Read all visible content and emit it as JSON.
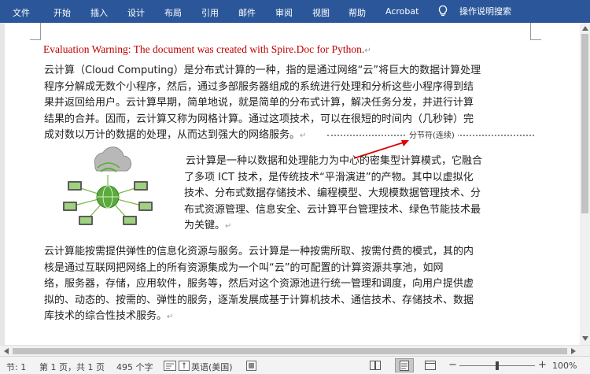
{
  "ribbon": {
    "tabs": [
      "文件",
      "开始",
      "插入",
      "设计",
      "布局",
      "引用",
      "邮件",
      "审阅",
      "视图",
      "帮助",
      "Acrobat"
    ],
    "help_label": "操作说明搜索",
    "color": "#2b579a"
  },
  "document": {
    "warning": "Evaluation Warning: The document was created with Spire.Doc for Python.",
    "para1_lines": [
      "云计算（Cloud Computing）是分布式计算的一种，指的是通过网络“云”将巨大的数据计算处理",
      "程序分解成无数个小程序，然后，通过多部服务器组成的系统进行处理和分析这些小程序得到结",
      "果并返回给用户。云计算早期，简单地说，就是简单的分布式计算，解决任务分发，并进行计算",
      "结果的合并。因而，云计算又称为网格计算。通过这项技术，可以在很短的时间内（几秒钟）完",
      "成对数以万计的数据的处理，从而达到强大的网络服务。"
    ],
    "section_break_label": "分节符(连续)",
    "para2_lines": [
      "云计算是一种以数据和处理能力为中心的密集型计算模式，它融合",
      "了多项 ICT 技术，是传统技术“平滑演进”的产物。其中以虚拟化",
      "技术、分布式数据存储技术、编程模型、大规模数据管理技术、分",
      "布式资源管理、信息安全、云计算平台管理技术、绿色节能技术最",
      "为关键。"
    ],
    "para3_lines": [
      "云计算能按需提供弹性的信息化资源与服务。云计算是一种按需所取、按需付费的模式，其的内",
      "核是通过互联网把网络上的所有资源集成为一个叫“云”的可配置的计算资源共享池，如网",
      "络，服务器，存储，应用软件，服务等，然后对这个资源池进行统一管理和调度，向用户提供虚",
      "拟的、动态的、按需的、弹性的服务，逐渐发展成基于计算机技术、通信技术、存储技术、数据",
      "库技术的综合性技术服务。"
    ],
    "paragraph_mark": "↵",
    "warning_color": "#c00000",
    "arrow_color": "#e00000"
  },
  "status": {
    "section": "节: 1",
    "page": "第 1 页，共 1 页",
    "words": "495 个字",
    "language": "英语(美国)",
    "zoom": "100%",
    "minus": "−",
    "plus": "+"
  }
}
